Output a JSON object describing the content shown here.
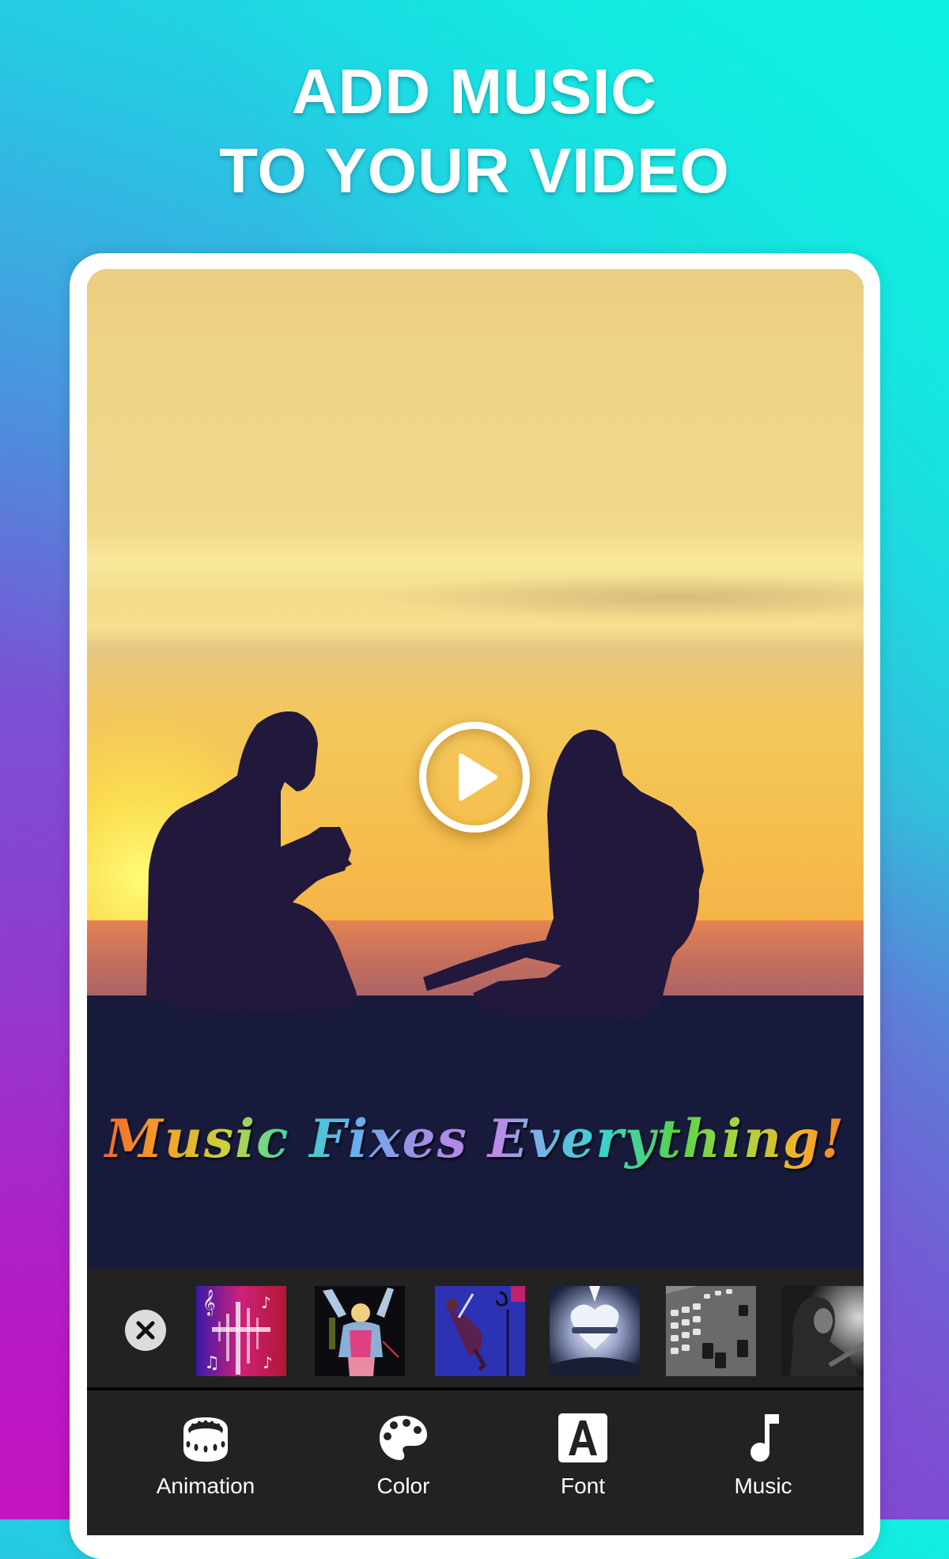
{
  "headline": {
    "line1": "ADD MUSIC",
    "line2": "TO YOUR VIDEO"
  },
  "video": {
    "caption": "Music Fixes Everything!",
    "play_icon": "play-icon"
  },
  "music_strip": {
    "close_icon": "close-icon",
    "thumbnails": [
      {
        "name": "music-notes-waveform",
        "colors": [
          "#3a1aa8",
          "#d0207a",
          "#e8e8ff"
        ]
      },
      {
        "name": "singer-on-stage",
        "colors": [
          "#0c0c10",
          "#8ab0d8",
          "#e88aa0"
        ]
      },
      {
        "name": "guitarist-jumping",
        "colors": [
          "#2a30b0",
          "#4048c8",
          "#c02070"
        ]
      },
      {
        "name": "book-heart",
        "colors": [
          "#1a2240",
          "#8a98c0",
          "#e8ecf4"
        ]
      },
      {
        "name": "mixing-console",
        "colors": [
          "#3a3a3a",
          "#9a9a9a",
          "#e0e0e0"
        ]
      },
      {
        "name": "rock-singer-bw",
        "colors": [
          "#1a1a1a",
          "#5a5a5a",
          "#d0d0d0"
        ]
      }
    ]
  },
  "toolbar": {
    "items": [
      {
        "label": "Animation",
        "icon": "film-reel-icon"
      },
      {
        "label": "Color",
        "icon": "palette-icon"
      },
      {
        "label": "Font",
        "icon": "font-icon"
      },
      {
        "label": "Music",
        "icon": "music-note-icon"
      }
    ]
  },
  "colors": {
    "bg_top_right": "#10f0e0",
    "bg_top_left": "#5a7ee0",
    "bg_bottom_left": "#c412c2",
    "bg_bottom_right": "#7a4ad4",
    "panel_dark": "#222222",
    "ground": "#171a3a"
  }
}
